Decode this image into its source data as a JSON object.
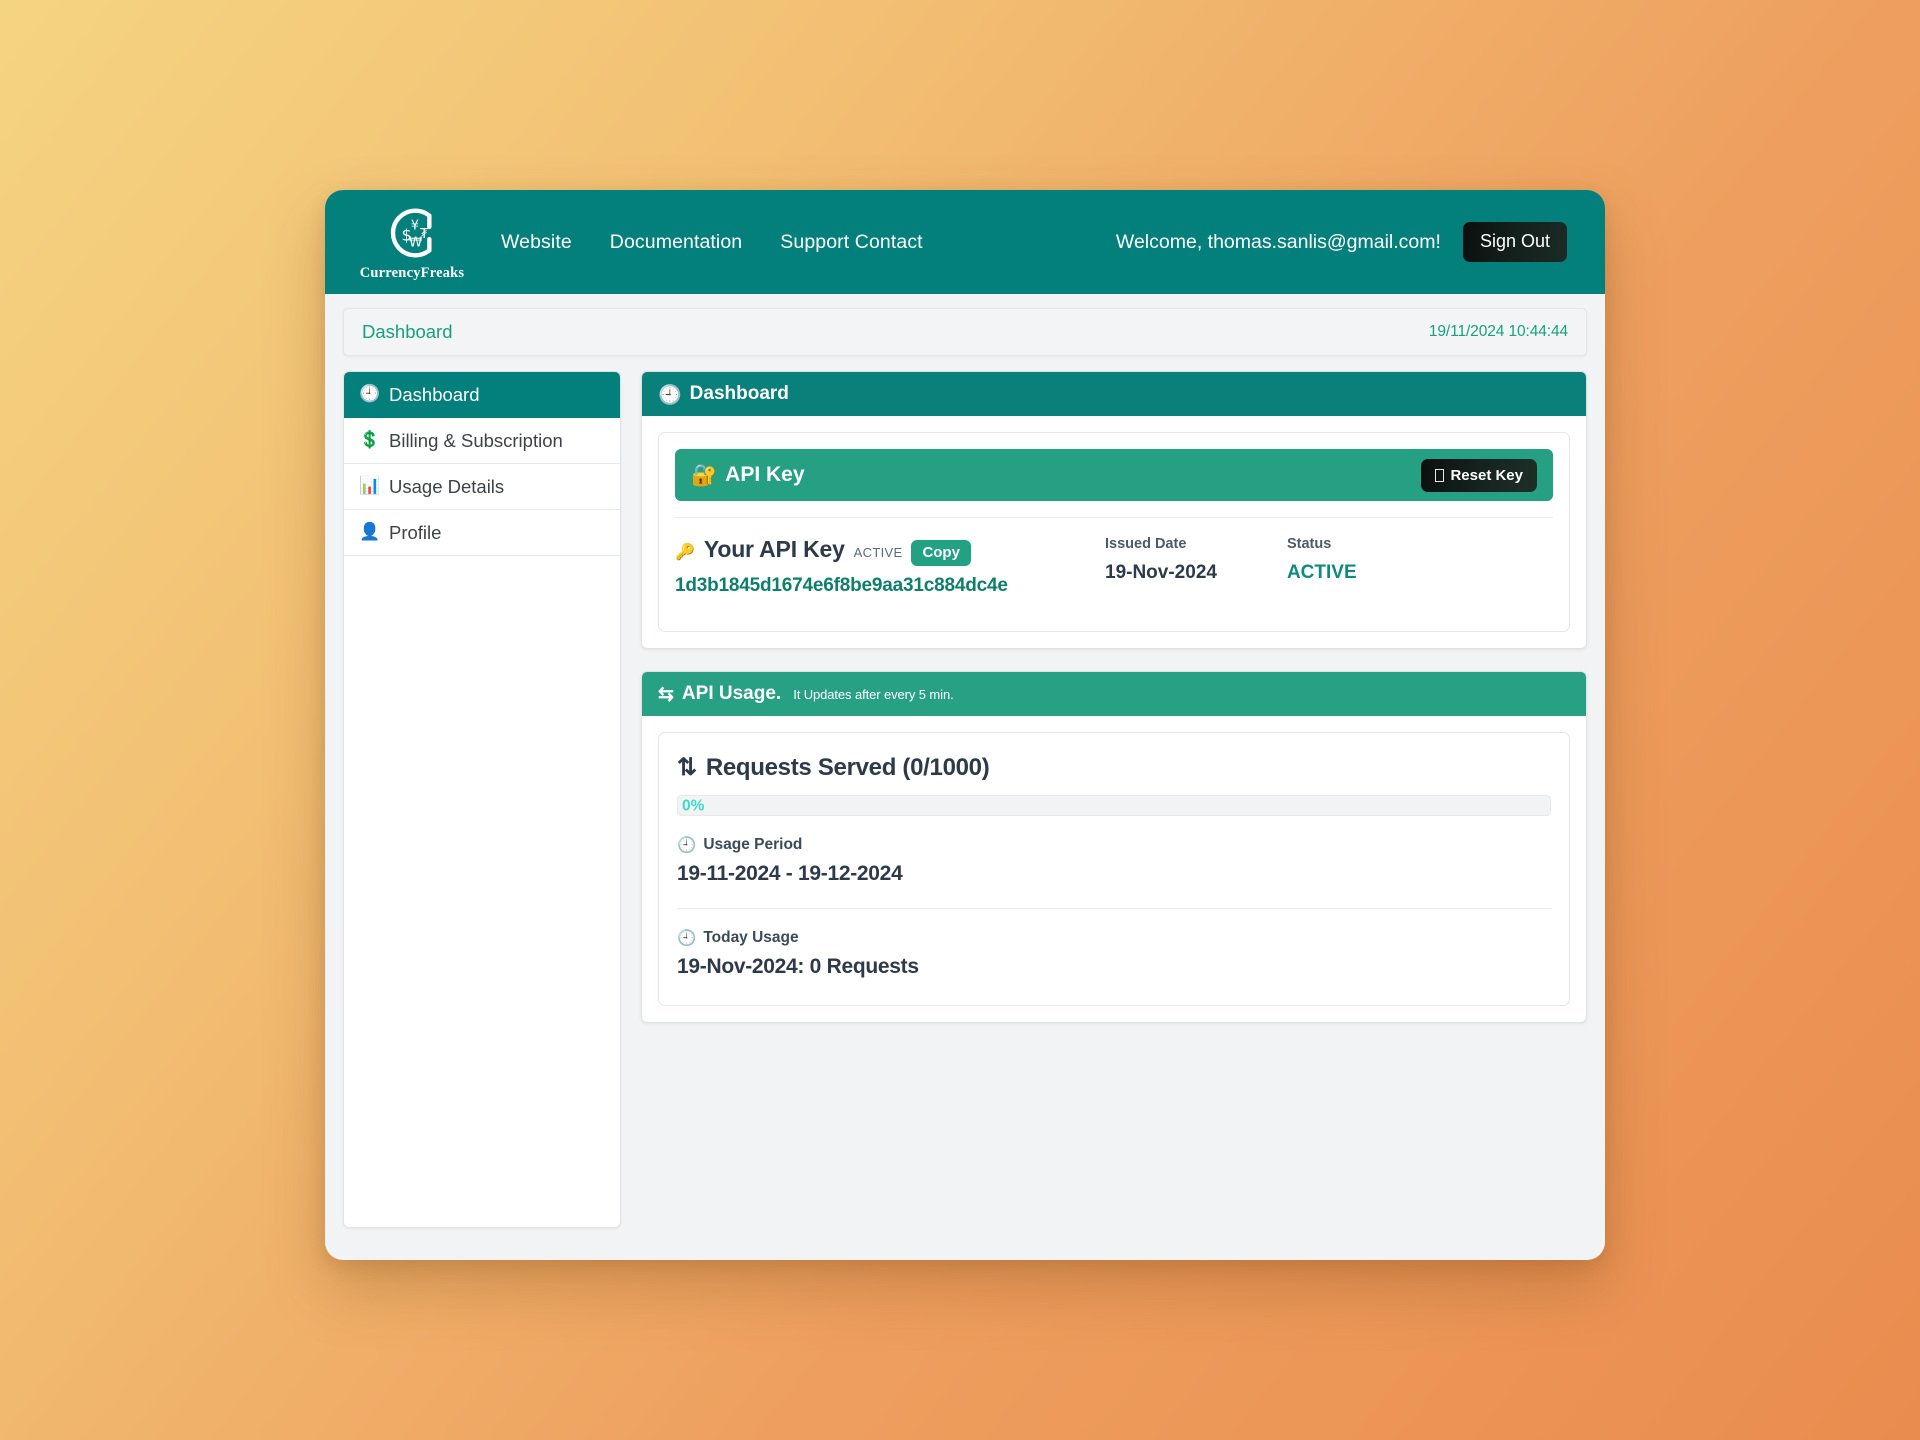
{
  "navbar": {
    "brand_name": "CurrencyFreaks",
    "logo_icon": "currencyfreaks-circle-logo",
    "links": [
      {
        "label": "Website",
        "name": "nav-link-website"
      },
      {
        "label": "Documentation",
        "name": "nav-link-documentation"
      },
      {
        "label": "Support Contact",
        "name": "nav-link-support-contact"
      }
    ],
    "welcome_text": "Welcome, thomas.sanlis@gmail.com!",
    "sign_out_label": "Sign Out"
  },
  "breadcrumb": {
    "title": "Dashboard",
    "datetime": "19/11/2024 10:44:44"
  },
  "sidebar": {
    "items": [
      {
        "label": "Dashboard",
        "icon": "clock-icon",
        "glyph": "🕘",
        "active": true
      },
      {
        "label": "Billing & Subscription",
        "icon": "dollar-icon",
        "glyph": "💲",
        "active": false
      },
      {
        "label": "Usage Details",
        "icon": "bar-chart-icon",
        "glyph": "📊",
        "active": false
      },
      {
        "label": "Profile",
        "icon": "person-icon",
        "glyph": "👤",
        "active": false
      }
    ]
  },
  "dashboard_panel": {
    "header_title": "Dashboard",
    "header_icon": "clock-icon",
    "header_glyph": "🕘"
  },
  "api_key_card": {
    "header_title": "API Key",
    "header_icon": "lock-with-key-icon",
    "header_glyph": "🔐",
    "reset_button_label": "Reset Key",
    "reset_button_icon": "missing-glyph-box",
    "key_icon": "key-icon",
    "key_glyph": "🔑",
    "key_title": "Your API Key",
    "key_state_badge": "ACTIVE",
    "copy_button_label": "Copy",
    "key_value": "1d3b1845d1674e6f8be9aa31c884dc4e",
    "issued_date_label": "Issued Date",
    "issued_date_value": "19-Nov-2024",
    "status_label": "Status",
    "status_value": "ACTIVE"
  },
  "api_usage_card": {
    "header_title": "API Usage.",
    "header_subtitle": "It Updates after every 5 min.",
    "header_icon": "swap-arrows-icon",
    "header_glyph": "⇆",
    "requests_icon": "up-down-arrows-icon",
    "requests_glyph": "⇅",
    "requests_title": "Requests Served (0/1000)",
    "requests_served": 0,
    "requests_limit": 1000,
    "progress_percent_label": "0%",
    "progress_percent": 0,
    "usage_period_label": "Usage Period",
    "usage_period_icon": "clock-icon",
    "usage_period_glyph": "🕘",
    "usage_period_value": "19-11-2024 - 19-12-2024",
    "today_usage_label": "Today Usage",
    "today_usage_icon": "clock-icon",
    "today_usage_glyph": "🕘",
    "today_usage_value": "19-Nov-2024: 0 Requests"
  },
  "colors": {
    "navbar_teal": "#04807c",
    "panel_green": "#27a083",
    "accent_green": "#199f7e",
    "key_text_green": "#0f7f6c",
    "progress_turquoise": "#3ed9cb",
    "dark_button": "#13201c",
    "page_bg_start": "#f5d481",
    "page_bg_end": "#e98c4f"
  }
}
